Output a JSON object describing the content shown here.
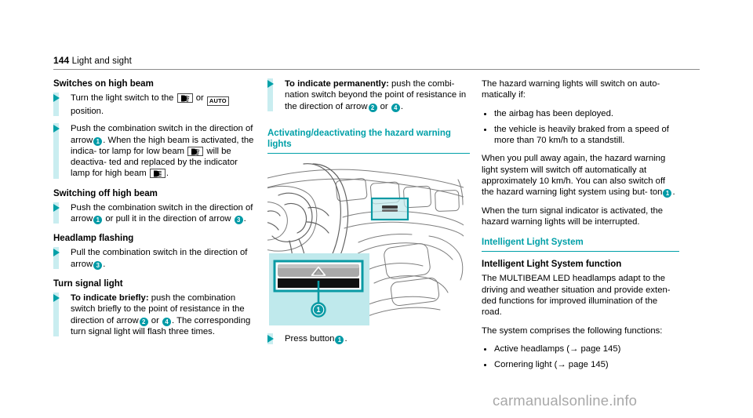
{
  "header": {
    "page_number": "144",
    "title": "Light and sight"
  },
  "left_column": {
    "heading_switches_on": "Switches on high beam",
    "step1": {
      "before": "Turn the light switch to the",
      "icon1": "low-beam-lamp-icon",
      "or": "or",
      "icon2": "AUTO",
      "after": "position."
    },
    "step2": {
      "line1": "Push the combination switch in the direction",
      "line2_before": "of arrow",
      "marker": "1",
      "line2_after": ".",
      "para_a": "When the high beam is activated, the indica-",
      "para_b": "tor lamp for low beam",
      "icon_low": "low-beam-lamp-icon",
      "para_c": "will be deactiva-",
      "para_d": "ted and replaced by the indicator lamp for",
      "para_e": "high beam",
      "icon_high": "high-beam-lamp-icon",
      "para_f": "."
    },
    "heading_switching_off": "Switching off high beam",
    "step3": {
      "line1": "Push the combination switch in the direction",
      "line2_before": "of arrow",
      "marker_a": "1",
      "line2_mid": "or pull it in the direction of arrow",
      "marker_b": "3",
      "line2_after": "."
    },
    "heading_headlamp_flashing": "Headlamp flashing",
    "step4": {
      "line1": "Pull the combination switch in the direction",
      "line2_before": "of arrow",
      "marker": "3",
      "line2_after": "."
    },
    "heading_turn_signal": "Turn signal light",
    "step5": {
      "lead": "To indicate briefly:",
      "line1_rest": "push the combination",
      "line2": "switch briefly to the point of resistance in the",
      "line3_before": "direction of arrow",
      "marker_a": "2",
      "line3_mid": "or",
      "marker_b": "4",
      "line3_after": ".",
      "line4": "The corresponding turn signal light will flash",
      "line5": "three times."
    }
  },
  "middle_column": {
    "step1": {
      "lead": "To indicate permanently:",
      "line1_rest": "push the combi-",
      "line2": "nation switch beyond the point of resistance",
      "line3_before": "in the direction of arrow",
      "marker_a": "2",
      "line3_mid": "or",
      "marker_b": "4",
      "line3_after": "."
    },
    "heading_activating": "Activating/deactivating the hazard warning lights",
    "figure": {
      "name": "dashboard-hazard-button-illustration",
      "callout_marker": "1"
    },
    "step2": {
      "before": "Press button",
      "marker": "1",
      "after": "."
    }
  },
  "right_column": {
    "para1": "The hazard warning lights will switch on auto-matically if:",
    "bullets": [
      "the airbag has been deployed.",
      "the vehicle is heavily braked from a speed of more than 70 km/h to a standstill."
    ],
    "para2_a": "When you pull away again, the hazard warning light system will switch off automatically at approximately 10 km/h. You can also switch off the hazard warning light system using but-",
    "para2_b_before": "ton",
    "para2_marker": "1",
    "para2_b_after": ".",
    "para3": "When the turn signal indicator is activated, the hazard warning lights will be interrupted.",
    "heading_ils": "Intelligent Light System",
    "subheading_ils": "Intelligent Light System function",
    "para4": "The MULTIBEAM LED headlamps adapt to the driving and weather situation and provide exten-ded functions for improved illumination of the road.",
    "para5": "The system comprises the following functions:",
    "functions": [
      "Active headlamps (→ page 145)",
      "Cornering light (→ page 145)"
    ]
  },
  "watermark": "carmanualsonline.info",
  "colors": {
    "teal": "#00a0a8",
    "teal_badge": "#009aa6",
    "pale_cyan": "#c9edf0",
    "rule_gray": "#8c8c8c",
    "watermark_gray": "#a8a8a8"
  }
}
